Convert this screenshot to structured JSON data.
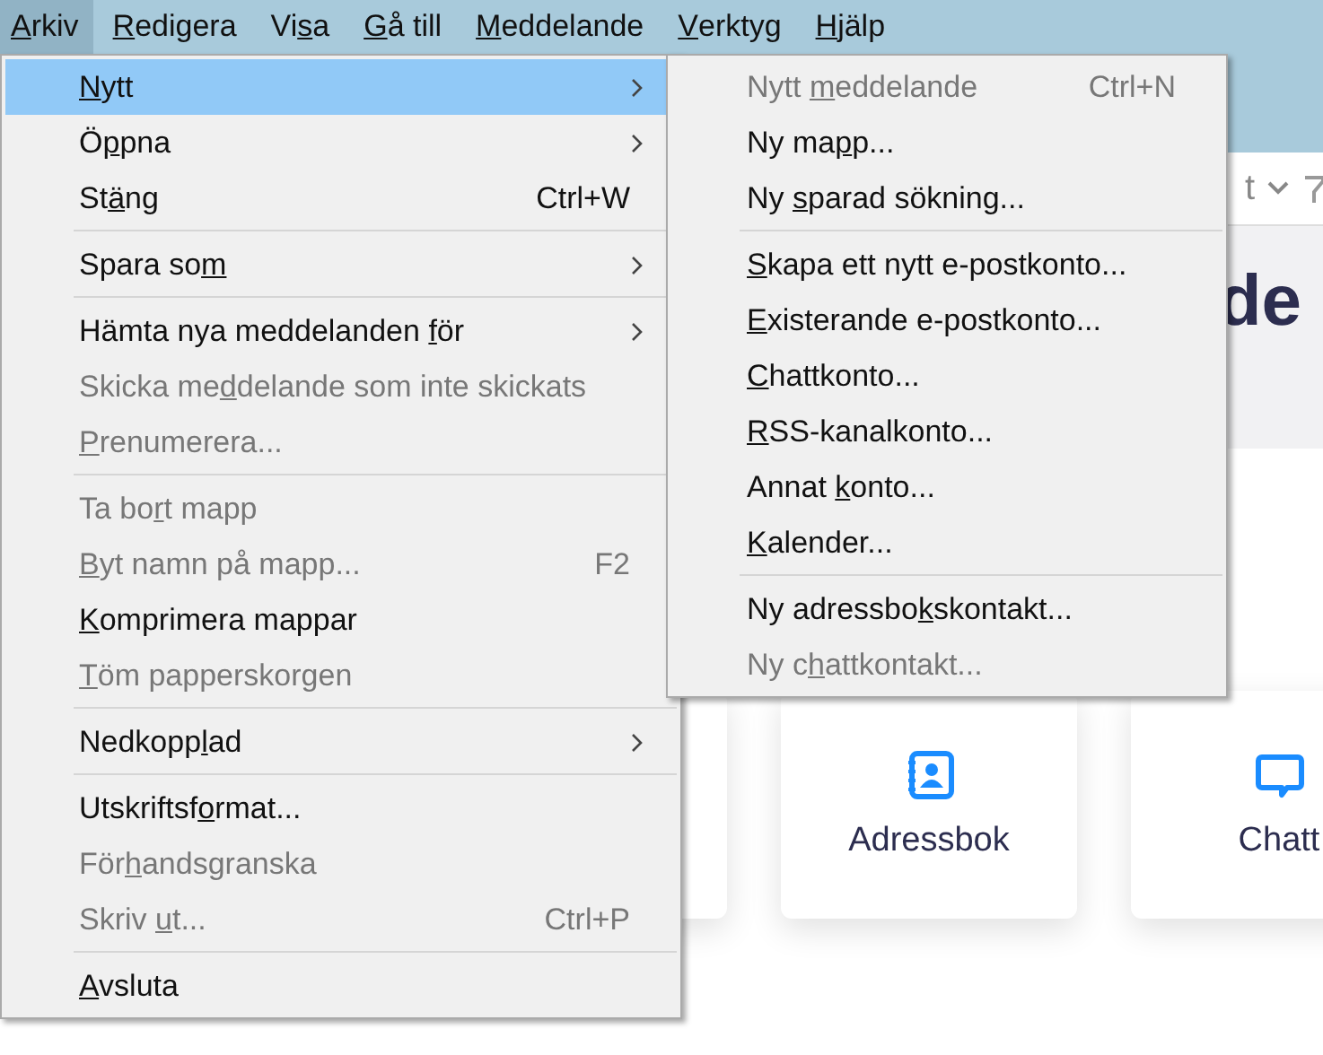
{
  "menubar": [
    {
      "key": "A",
      "post": "rkiv",
      "selected": true
    },
    {
      "key": "R",
      "post": "edigera",
      "selected": false
    },
    {
      "pre": "Vi",
      "key": "s",
      "post": "a",
      "selected": false
    },
    {
      "key": "G",
      "post": "å till",
      "selected": false
    },
    {
      "key": "M",
      "post": "eddelande",
      "selected": false
    },
    {
      "key": "V",
      "post": "erktyg",
      "selected": false
    },
    {
      "key": "H",
      "post": "jälp",
      "selected": false
    }
  ],
  "file_menu": [
    {
      "kind": "item",
      "key": "N",
      "post": "ytt",
      "disabled": false,
      "selected": true,
      "submenu": true
    },
    {
      "kind": "item",
      "pre": "Ö",
      "key": "p",
      "post": "pna",
      "disabled": false,
      "selected": false,
      "submenu": true
    },
    {
      "kind": "item",
      "pre": "St",
      "key": "ä",
      "post": "ng",
      "shortcut": "Ctrl+W",
      "disabled": false,
      "selected": false,
      "submenu": false
    },
    {
      "kind": "separator"
    },
    {
      "kind": "item",
      "pre": "Spara so",
      "key": "m",
      "disabled": false,
      "selected": false,
      "submenu": true
    },
    {
      "kind": "separator"
    },
    {
      "kind": "item",
      "pre": "Hämta nya meddelanden ",
      "key": "f",
      "post": "ör",
      "disabled": false,
      "selected": false,
      "submenu": true
    },
    {
      "kind": "item",
      "pre": "Skicka me",
      "key": "d",
      "post": "delande som inte skickats",
      "disabled": true,
      "selected": false,
      "submenu": false
    },
    {
      "kind": "item",
      "key": "P",
      "post": "renumerera...",
      "disabled": true,
      "selected": false,
      "submenu": false
    },
    {
      "kind": "separator"
    },
    {
      "kind": "item",
      "pre": "Ta bo",
      "key": "r",
      "post": "t mapp",
      "disabled": true,
      "selected": false,
      "submenu": false
    },
    {
      "kind": "item",
      "key": "B",
      "post": "yt namn på mapp...",
      "shortcut": "F2",
      "disabled": true,
      "selected": false,
      "submenu": false
    },
    {
      "kind": "item",
      "key": "K",
      "post": "omprimera mappar",
      "disabled": false,
      "selected": false,
      "submenu": false
    },
    {
      "kind": "item",
      "key": "T",
      "post": "öm papperskorgen",
      "disabled": true,
      "selected": false,
      "submenu": false
    },
    {
      "kind": "separator"
    },
    {
      "kind": "item",
      "pre": "Nedkopp",
      "key": "l",
      "post": "ad",
      "disabled": false,
      "selected": false,
      "submenu": true
    },
    {
      "kind": "separator"
    },
    {
      "kind": "item",
      "pre": "Utskriftsf",
      "key": "o",
      "post": "rmat...",
      "disabled": false,
      "selected": false,
      "submenu": false
    },
    {
      "kind": "item",
      "pre": "För",
      "key": "h",
      "post": "andsgranska",
      "disabled": true,
      "selected": false,
      "submenu": false
    },
    {
      "kind": "item",
      "pre": "Skriv ",
      "key": "u",
      "post": "t...",
      "shortcut": "Ctrl+P",
      "disabled": true,
      "selected": false,
      "submenu": false
    },
    {
      "kind": "separator"
    },
    {
      "kind": "item",
      "key": "A",
      "post": "vsluta",
      "disabled": false,
      "selected": false,
      "submenu": false
    }
  ],
  "new_submenu": [
    {
      "kind": "item",
      "pre": "Nytt ",
      "key": "m",
      "post": "eddelande",
      "shortcut": "Ctrl+N",
      "disabled": true,
      "selected": false,
      "submenu": false
    },
    {
      "kind": "item",
      "pre": "Ny ma",
      "key": "p",
      "post": "p...",
      "disabled": false,
      "selected": false,
      "submenu": false
    },
    {
      "kind": "item",
      "pre": "Ny ",
      "key": "s",
      "post": "parad sökning...",
      "disabled": false,
      "selected": false,
      "submenu": false
    },
    {
      "kind": "separator"
    },
    {
      "kind": "item",
      "key": "S",
      "post": "kapa ett nytt e-postkonto...",
      "disabled": false,
      "selected": false,
      "submenu": false
    },
    {
      "kind": "item",
      "key": "E",
      "post": "xisterande e-postkonto...",
      "disabled": false,
      "selected": false,
      "submenu": false
    },
    {
      "kind": "item",
      "key": "C",
      "post": "hattkonto...",
      "disabled": false,
      "selected": false,
      "submenu": false
    },
    {
      "kind": "item",
      "key": "R",
      "post": "SS-kanalkonto...",
      "disabled": false,
      "selected": false,
      "submenu": false
    },
    {
      "kind": "item",
      "pre": "Annat ",
      "key": "k",
      "post": "onto...",
      "disabled": false,
      "selected": false,
      "submenu": false
    },
    {
      "kind": "item",
      "key": "K",
      "post": "alender...",
      "disabled": false,
      "selected": false,
      "submenu": false
    },
    {
      "kind": "separator"
    },
    {
      "kind": "item",
      "pre": "Ny adressbo",
      "key": "k",
      "post": "skontakt...",
      "disabled": false,
      "selected": false,
      "submenu": false
    },
    {
      "kind": "item",
      "pre": "Ny c",
      "key": "h",
      "post": "attkontakt...",
      "disabled": true,
      "selected": false,
      "submenu": false
    }
  ],
  "toolbar": {
    "dropdown_label": "t"
  },
  "heading": "de",
  "cards": [
    {
      "kind": "blank"
    },
    {
      "kind": "address_book",
      "label": "Adressbok"
    },
    {
      "kind": "chat",
      "label": "Chatt"
    }
  ]
}
